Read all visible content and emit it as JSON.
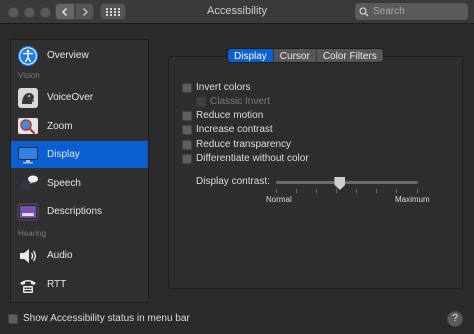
{
  "window": {
    "title": "Accessibility"
  },
  "toolbar": {
    "search_placeholder": "Search"
  },
  "sidebar": {
    "items": [
      {
        "label": "Overview",
        "icon": "accessibility-icon"
      },
      {
        "label": "VoiceOver",
        "icon": "voiceover-icon"
      },
      {
        "label": "Zoom",
        "icon": "zoom-icon"
      },
      {
        "label": "Display",
        "icon": "display-icon",
        "selected": true
      },
      {
        "label": "Speech",
        "icon": "speech-icon"
      },
      {
        "label": "Descriptions",
        "icon": "descriptions-icon"
      },
      {
        "label": "Audio",
        "icon": "audio-icon"
      },
      {
        "label": "RTT",
        "icon": "rtt-icon"
      }
    ],
    "groups": {
      "vision": "Vision",
      "hearing": "Hearing"
    }
  },
  "tabs": [
    "Display",
    "Cursor",
    "Color Filters"
  ],
  "active_tab": "Display",
  "options": [
    {
      "label": "Invert colors",
      "checked": false
    },
    {
      "label": "Classic Invert",
      "checked": false,
      "disabled": true
    },
    {
      "label": "Reduce motion",
      "checked": false
    },
    {
      "label": "Increase contrast",
      "checked": false
    },
    {
      "label": "Reduce transparency",
      "checked": false
    },
    {
      "label": "Differentiate without color",
      "checked": false
    }
  ],
  "contrast": {
    "label": "Display contrast:",
    "min_label": "Normal",
    "max_label": "Maximum",
    "value": 0.45
  },
  "footer": {
    "menu_bar_label": "Show Accessibility status in menu bar",
    "menu_bar_checked": false,
    "help": "?"
  },
  "colors": {
    "accent": "#0a5fd1",
    "background": "#2b2b2b"
  }
}
